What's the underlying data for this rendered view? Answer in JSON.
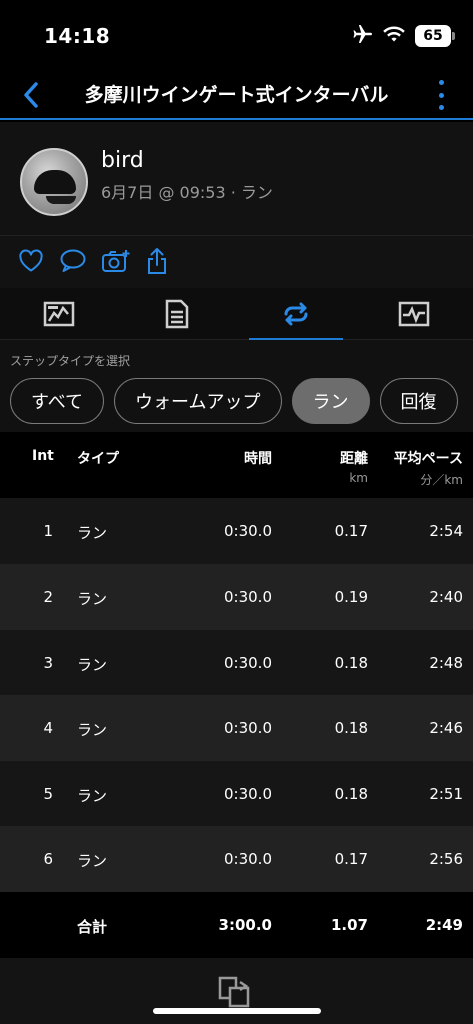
{
  "status": {
    "time": "14:18",
    "battery": "65"
  },
  "nav": {
    "title": "多摩川ウインゲート式インターバル"
  },
  "user": {
    "name": "bird",
    "meta": "6月7日 @ 09:53 · ラン"
  },
  "filter": {
    "label": "ステップタイプを選択",
    "chips": [
      "すべて",
      "ウォームアップ",
      "ラン",
      "回復"
    ]
  },
  "table": {
    "headers": {
      "int": "Int",
      "type": "タイプ",
      "time": "時間",
      "distance": "距離",
      "distance_unit": "km",
      "pace": "平均ペース",
      "pace_unit": "分／km"
    },
    "rows": [
      {
        "int": "1",
        "type": "ラン",
        "time": "0:30.0",
        "distance": "0.17",
        "pace": "2:54"
      },
      {
        "int": "2",
        "type": "ラン",
        "time": "0:30.0",
        "distance": "0.19",
        "pace": "2:40"
      },
      {
        "int": "3",
        "type": "ラン",
        "time": "0:30.0",
        "distance": "0.18",
        "pace": "2:48"
      },
      {
        "int": "4",
        "type": "ラン",
        "time": "0:30.0",
        "distance": "0.18",
        "pace": "2:46"
      },
      {
        "int": "5",
        "type": "ラン",
        "time": "0:30.0",
        "distance": "0.18",
        "pace": "2:51"
      },
      {
        "int": "6",
        "type": "ラン",
        "time": "0:30.0",
        "distance": "0.17",
        "pace": "2:56"
      }
    ],
    "totals": {
      "label": "合計",
      "time": "3:00.0",
      "distance": "1.07",
      "pace": "2:49"
    }
  },
  "colors": {
    "accent": "#1e7bd6",
    "background": "#000000"
  }
}
